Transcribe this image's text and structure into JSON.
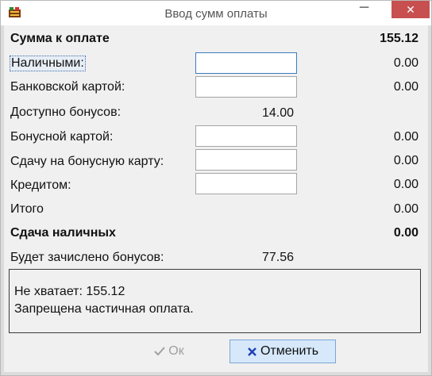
{
  "window": {
    "title": "Ввод сумм оплаты",
    "minimize_glyph": "─",
    "close_glyph": "✕",
    "icon": "app-icon"
  },
  "form": {
    "total_label": "Сумма к оплате",
    "total_value": "155.12",
    "cash_label": "Наличными:",
    "cash_value": "0.00",
    "bank_card_label": "Банковской картой:",
    "bank_card_value": "0.00",
    "bonus_available_label": "Доступно бонусов:",
    "bonus_available_value": "14.00",
    "bonus_card_label": "Бонусной картой:",
    "bonus_card_value": "0.00",
    "change_to_bonus_label": "Сдачу на бонусную карту:",
    "change_to_bonus_value": "0.00",
    "credit_label": "Кредитом:",
    "credit_value": "0.00",
    "itogo_label": "Итого",
    "itogo_value": "0.00",
    "change_cash_label": "Сдача наличных",
    "change_cash_value": "0.00",
    "bonus_accrued_label": "Будет зачислено бонусов:",
    "bonus_accrued_value": "77.56",
    "inputs": {
      "cash": "",
      "bank_card": "",
      "bonus_card": "",
      "change_to_bonus": "",
      "credit": ""
    }
  },
  "message": {
    "line1": "Не хватает: 155.12",
    "line2": "Запрещена частичная оплата."
  },
  "buttons": {
    "ok_label": "Ок",
    "cancel_label": "Отменить",
    "ok_icon": "checkmark-icon",
    "cancel_icon": "cross-icon"
  },
  "colors": {
    "close_button": "#c74f4f",
    "cancel_button_bg": "#d6e8fa",
    "cancel_icon": "#1f3fb5",
    "ok_disabled": "#a0a0a0"
  }
}
